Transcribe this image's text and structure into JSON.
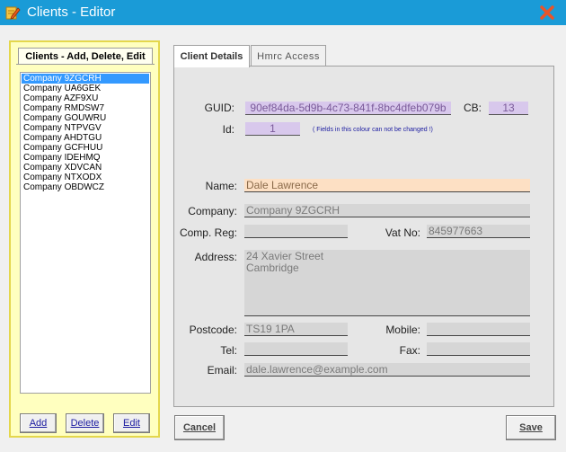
{
  "window": {
    "title": "Clients - Editor"
  },
  "left_panel": {
    "tab_label": "Clients - Add, Delete, Edit",
    "clients": [
      "Company 9ZGCRH",
      "Company UA6GEK",
      "Company AZF9XU",
      "Company RMDSW7",
      "Company GOUWRU",
      "Company NTPVGV",
      "Company AHDTGU",
      "Company GCFHUU",
      "Company IDEHMQ",
      "Company XDVCAN",
      "Company NTXODX",
      "Company OBDWCZ"
    ],
    "selected_index": 0,
    "buttons": {
      "add": "Add",
      "delete": "Delete",
      "edit": "Edit"
    }
  },
  "tabs": {
    "client_details": "Client Details",
    "hmrc_access": "Hmrc Access"
  },
  "form": {
    "guid_label": "GUID:",
    "guid_value": "90ef84da-5d9b-4c73-841f-8bc4dfeb079b",
    "cb_label": "CB:",
    "cb_value": "13",
    "id_label": "Id:",
    "id_value": "1",
    "note": "( Fields in this colour can not be changed !)",
    "name_label": "Name:",
    "name_value": "Dale Lawrence",
    "company_label": "Company:",
    "company_value": "Company 9ZGCRH",
    "comp_reg_label": "Comp. Reg:",
    "comp_reg_value": "",
    "vat_label": "Vat No:",
    "vat_value": "845977663",
    "address_label": "Address:",
    "address_value": "24 Xavier Street\nCambridge",
    "postcode_label": "Postcode:",
    "postcode_value": "TS19 1PA",
    "mobile_label": "Mobile:",
    "mobile_value": "",
    "tel_label": "Tel:",
    "tel_value": "",
    "fax_label": "Fax:",
    "fax_value": "",
    "email_label": "Email:",
    "email_value": "dale.lawrence@example.com"
  },
  "footer": {
    "cancel": "Cancel",
    "save": "Save"
  },
  "colors": {
    "titlebar": "#1a9bd7",
    "locked_field": "#d8c8ec",
    "name_field": "#fde0c4",
    "panel_border": "#e4d74c"
  },
  "icons": {
    "app": "edit-document-icon",
    "close": "close-icon"
  }
}
